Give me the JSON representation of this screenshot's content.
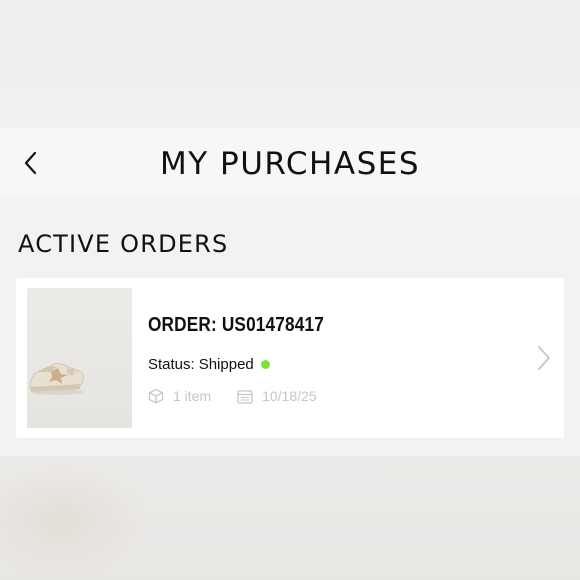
{
  "header": {
    "title": "MY PURCHASES",
    "back_icon": "chevron-left-icon"
  },
  "section": {
    "title": "ACTIVE ORDERS"
  },
  "order": {
    "id_label": "ORDER: US01478417",
    "status_label": "Status:",
    "status_value": "Shipped",
    "status_color": "#7ee13a",
    "item_count": "1 item",
    "date": "10/18/25",
    "thumbnail": "sneaker-product-image"
  },
  "colors": {
    "background": "#efeeec",
    "card": "#ffffff",
    "muted_text": "#c5c5c5"
  }
}
